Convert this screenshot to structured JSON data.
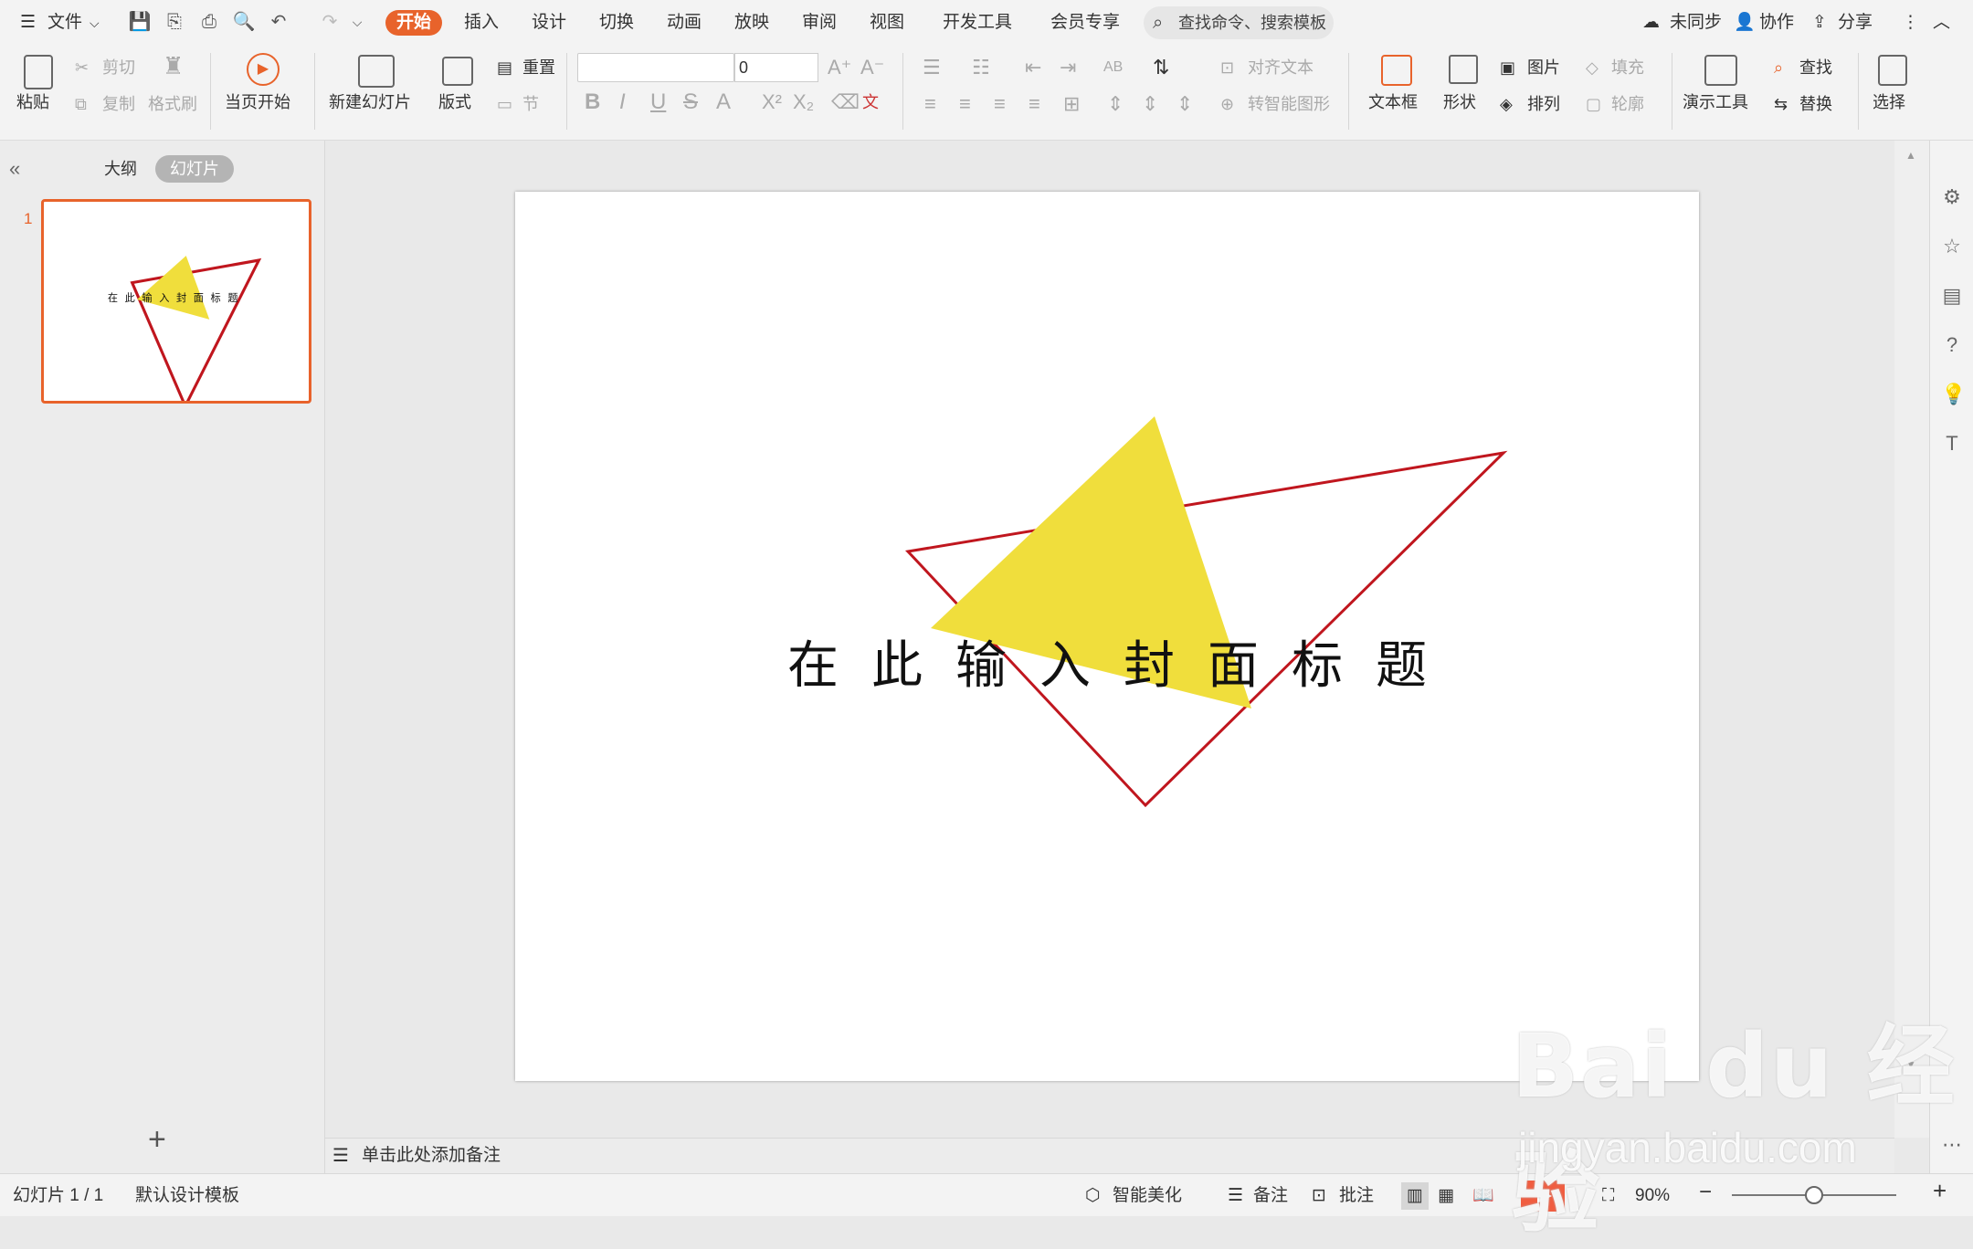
{
  "menu": {
    "file": "文件",
    "tabs": [
      "开始",
      "插入",
      "设计",
      "切换",
      "动画",
      "放映",
      "审阅",
      "视图",
      "开发工具",
      "会员专享"
    ],
    "search": "查找命令、搜索模板",
    "sync": "未同步",
    "collab": "协作",
    "share": "分享"
  },
  "ribbon": {
    "paste": "粘贴",
    "cut": "剪切",
    "copy": "复制",
    "format_painter": "格式刷",
    "from_current": "当页开始",
    "new_slide": "新建幻灯片",
    "layout": "版式",
    "reset": "重置",
    "section": "节",
    "font_size": "0",
    "align_text": "对齐文本",
    "smart_shape": "转智能图形",
    "textbox": "文本框",
    "shape": "形状",
    "picture": "图片",
    "arrange": "排列",
    "fill": "填充",
    "outline": "轮廓",
    "present_tools": "演示工具",
    "find": "查找",
    "replace": "替换",
    "select": "选择"
  },
  "leftpane": {
    "outline_tab": "大纲",
    "slides_tab": "幻灯片",
    "slide_num": "1",
    "add": "+"
  },
  "slide": {
    "title": "在此输入封面标题",
    "tri_yellow": "#f0de3c",
    "tri_red": "#c0161e"
  },
  "notes": "单击此处添加备注",
  "status": {
    "slide_info": "幻灯片 1 / 1",
    "template": "默认设计模板",
    "beautify": "智能美化",
    "notes": "备注",
    "comment": "批注",
    "zoom": "90%"
  },
  "watermark": {
    "logo": "Bai du 经验",
    "url": "jingyan.baidu.com"
  }
}
